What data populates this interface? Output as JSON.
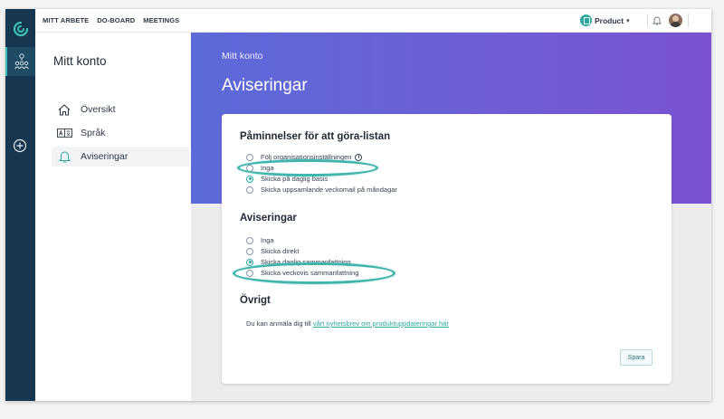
{
  "topbar": {
    "nav": [
      "MITT ARBETE",
      "DO-BOARD",
      "MEETINGS"
    ],
    "product_label": "Product",
    "notification_count": "1"
  },
  "sidebar": {
    "title": "Mitt konto",
    "items": [
      {
        "label": "Översikt",
        "icon": "home-icon"
      },
      {
        "label": "Språk",
        "icon": "language-icon"
      },
      {
        "label": "Aviseringar",
        "icon": "bell-icon",
        "active": true
      }
    ]
  },
  "header": {
    "breadcrumb": "Mitt konto",
    "title": "Aviseringar"
  },
  "reminders": {
    "title": "Påminnelser för att göra-listan",
    "options": [
      {
        "label": "Följ organisationsinställningen",
        "checked": false,
        "info": true
      },
      {
        "label": "Inga",
        "checked": false
      },
      {
        "label": "Skicka på daglig basis",
        "checked": true
      },
      {
        "label": "Skicka uppsamlande veckomail på måndagar",
        "checked": false
      }
    ]
  },
  "notifications": {
    "title": "Aviseringar",
    "options": [
      {
        "label": "Inga",
        "checked": false
      },
      {
        "label": "Skicka direkt",
        "checked": false
      },
      {
        "label": "Skicka daglig sammanfattning",
        "checked": true
      },
      {
        "label": "Skicka veckovis sammanfattning",
        "checked": false
      }
    ]
  },
  "other": {
    "title": "Övrigt",
    "text": "Du kan anmäla dig till",
    "link": "vårt nyhetsbrev om produktuppdateringar här"
  },
  "save_label": "Spara",
  "colors": {
    "rail": "#16374f",
    "accent": "#2ba8a0",
    "hero_start": "#5c6ad8",
    "hero_end": "#7a52d2",
    "annotation": "#3fb5ad"
  }
}
